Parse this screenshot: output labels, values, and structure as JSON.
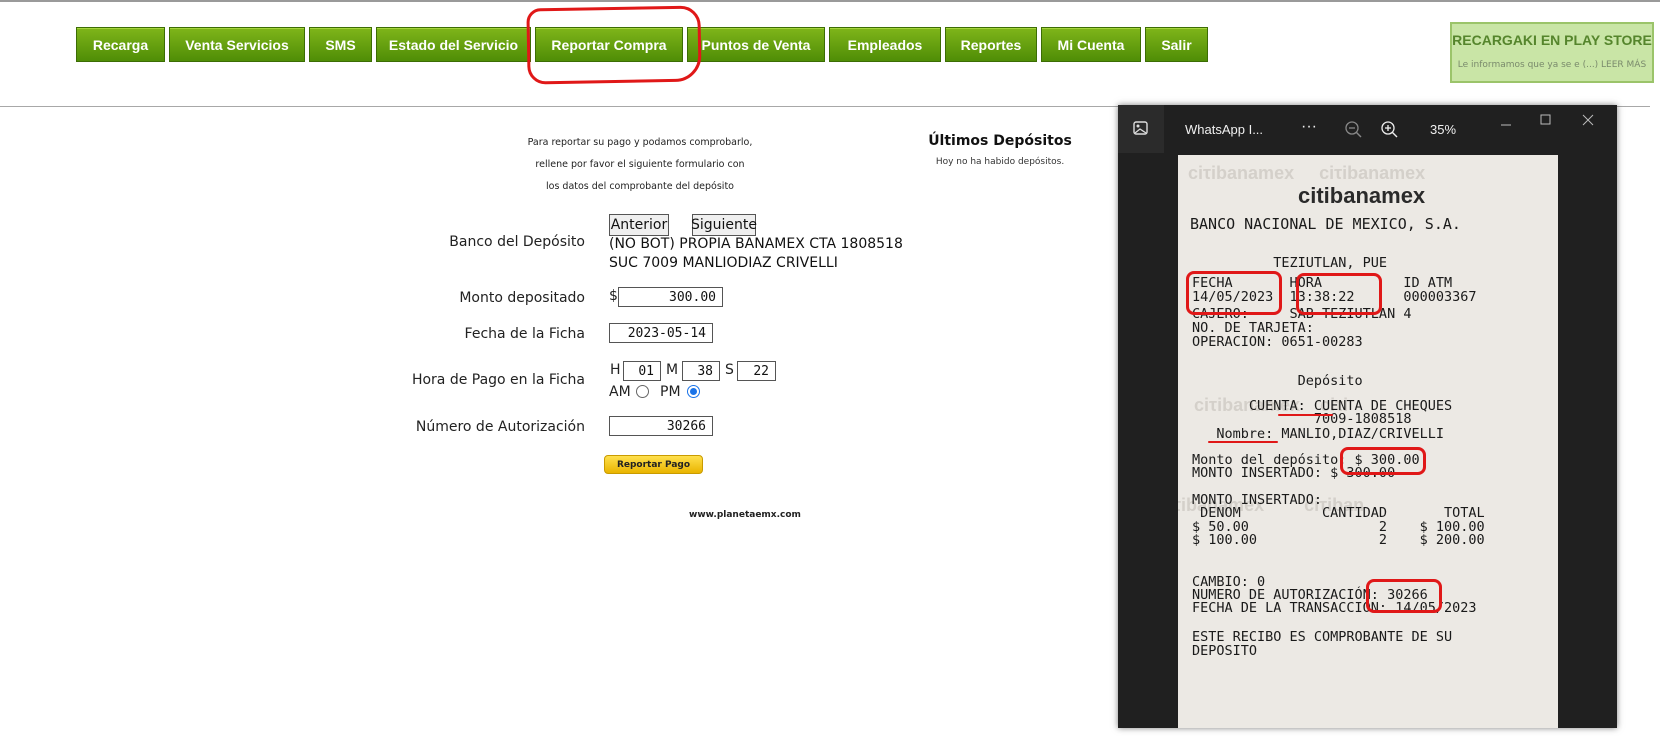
{
  "nav": [
    "Recarga",
    "Venta Servicios",
    "SMS",
    "Estado del Servicio",
    "Reportar Compra",
    "Puntos de Venta",
    "Empleados",
    "Reportes",
    "Mi Cuenta",
    "Salir"
  ],
  "promo": {
    "title": "RECARGAKI EN PLAY STORE",
    "text": "Le informamos que ya se e (...) LEER MÁS"
  },
  "intro": [
    "Para reportar su pago y podamos comprobarlo,",
    "rellene por favor el siguiente formulario con",
    "los datos del comprobante del depósito"
  ],
  "ultimos": {
    "title": "Últimos Depósitos",
    "text": "Hoy no ha habido depósitos."
  },
  "form": {
    "banco_label": "Banco del Depósito",
    "anterior": "Anterior",
    "siguiente": "Siguiente",
    "banco_line1": "(NO BOT) PROPIA BANAMEX CTA 1808518",
    "banco_line2": "SUC 7009 MANLIODIAZ CRIVELLI",
    "monto_label": "Monto depositado",
    "currency": "$",
    "monto": "300.00",
    "fecha_label": "Fecha de la Ficha",
    "fecha": "2023-05-14",
    "hora_label": "Hora de Pago en la Ficha",
    "h_label": "H",
    "h": "01",
    "m_label": "M",
    "m": "38",
    "s_label": "S",
    "s": "22",
    "am": "AM",
    "pm": "PM",
    "pm_selected": true,
    "auth_label": "Número de Autorización",
    "auth": "30266",
    "report_btn": "Reportar Pago"
  },
  "footer": "www.planetaemx.com",
  "viewer": {
    "title": "WhatsApp I...",
    "more": "···",
    "zoom": "35%"
  },
  "receipt": {
    "logo": "citibanamex",
    "lines": [
      "BANCO NACIONAL DE MEXICO, S.A.",
      "          TEZIUTLAN, PUE",
      "FECHA       HORA          ID ATM",
      "14/05/2023  13:38:22      000003367",
      "CAJERO:     SAB TEZIUTLAN 4",
      "NO. DE TARJETA:",
      "OPERACION: 0651-00283",
      "             Depósito",
      "       CUENTA: CUENTA DE CHEQUES",
      "               7009-1808518",
      "   Nombre: MANLIO,DIAZ/CRIVELLI",
      "Monto del depósito: $ 300.00",
      "MONTO INSERTADO: $ 300.00",
      "MONTO INSERTADO:",
      " DENOM          CANTIDAD       TOTAL",
      "$ 50.00                2    $ 100.00",
      "$ 100.00               2    $ 200.00",
      "CAMBIO: 0",
      "NUMERO DE AUTORIZACIÓN: 30266",
      "FECHA DE LA TRANSACCIÓN: 14/05/2023",
      "ESTE RECIBO ES COMPROBANTE DE SU",
      "DEPOSITO"
    ]
  }
}
